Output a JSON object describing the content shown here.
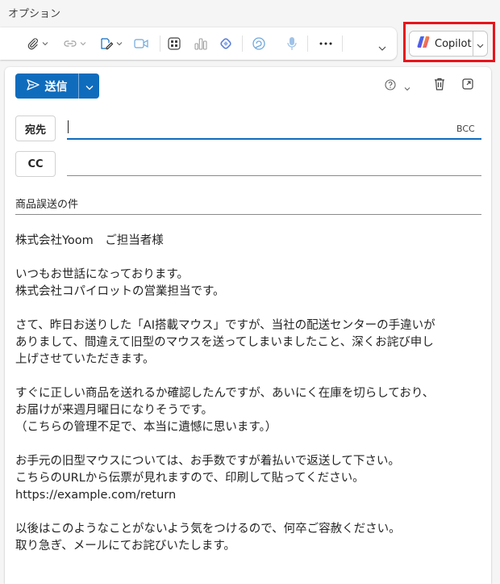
{
  "options_tab": "オプション",
  "toolbar": {
    "icons": [
      "paperclip-icon",
      "link-icon",
      "signature-icon",
      "meeting-icon",
      "apps-icon",
      "poll-icon",
      "loop-icon",
      "viva-icon",
      "dictate-icon",
      "more-icon",
      "expand-icon"
    ]
  },
  "copilot": {
    "label": "Copilot"
  },
  "compose": {
    "send_label": "送信",
    "to_label": "宛先",
    "cc_label": "CC",
    "bcc_label": "BCC",
    "to_value": "",
    "cc_value": "",
    "subject": "商品誤送の件",
    "body_lines": [
      "株式会社Yoom　ご担当者様",
      "",
      "いつもお世話になっております。",
      "株式会社コパイロットの営業担当です。",
      "",
      "さて、昨日お送りした「AI搭載マウス」ですが、当社の配送センターの手違いが",
      "ありまして、間違えて旧型のマウスを送ってしまいましたこと、深くお詫び申し",
      "上げさせていただきます。",
      "",
      "すぐに正しい商品を送れるか確認したんですが、あいにく在庫を切らしており、",
      "お届けが来週月曜日になりそうです。",
      "（こちらの管理不足で、本当に遺憾に思います。）",
      "",
      "お手元の旧型マウスについては、お手数ですが着払いで返送して下さい。",
      "こちらのURLから伝票が見れますので、印刷して貼ってください。",
      "https://example.com/return",
      "",
      "以後はこのようなことがないよう気をつけるので、何卒ご容赦ください。",
      "取り急ぎ、メールにてお詫びいたします。"
    ]
  },
  "colors": {
    "accent": "#0f6cbd",
    "highlight": "#e8141b"
  }
}
